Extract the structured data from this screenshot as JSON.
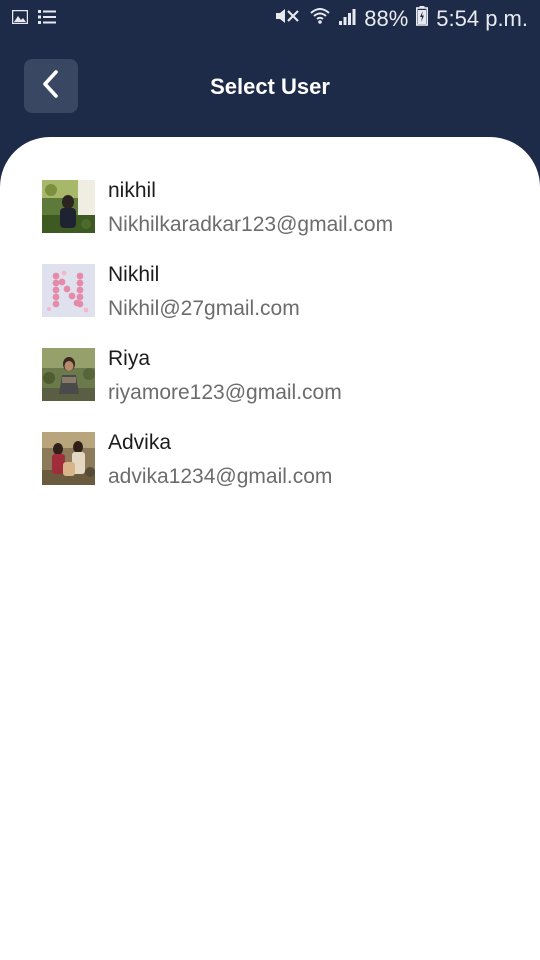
{
  "status_bar": {
    "battery_percent": "88%",
    "time": "5:54 p.m.",
    "icons": [
      "gallery-icon",
      "list-icon",
      "mute-icon",
      "wifi-icon",
      "signal-icon",
      "battery-icon"
    ]
  },
  "header": {
    "title": "Select User",
    "back_icon": "chevron-left-icon"
  },
  "colors": {
    "header_bg": "#1d2a48",
    "back_button_bg": "#3a4763",
    "sheet_bg": "#ffffff",
    "name_text": "#1c1c1c",
    "email_text": "#6c6c6c"
  },
  "users": [
    {
      "name": "nikhil",
      "email": "Nikhilkaradkar123@gmail.com",
      "avatar": "photo-person-outdoor"
    },
    {
      "name": "Nikhil",
      "email": "Nikhil@27gmail.com",
      "avatar": "photo-flower-letter-n"
    },
    {
      "name": "Riya",
      "email": "riyamore123@gmail.com",
      "avatar": "photo-person-trees"
    },
    {
      "name": "Advika",
      "email": "advika1234@gmail.com",
      "avatar": "photo-group-people"
    }
  ]
}
